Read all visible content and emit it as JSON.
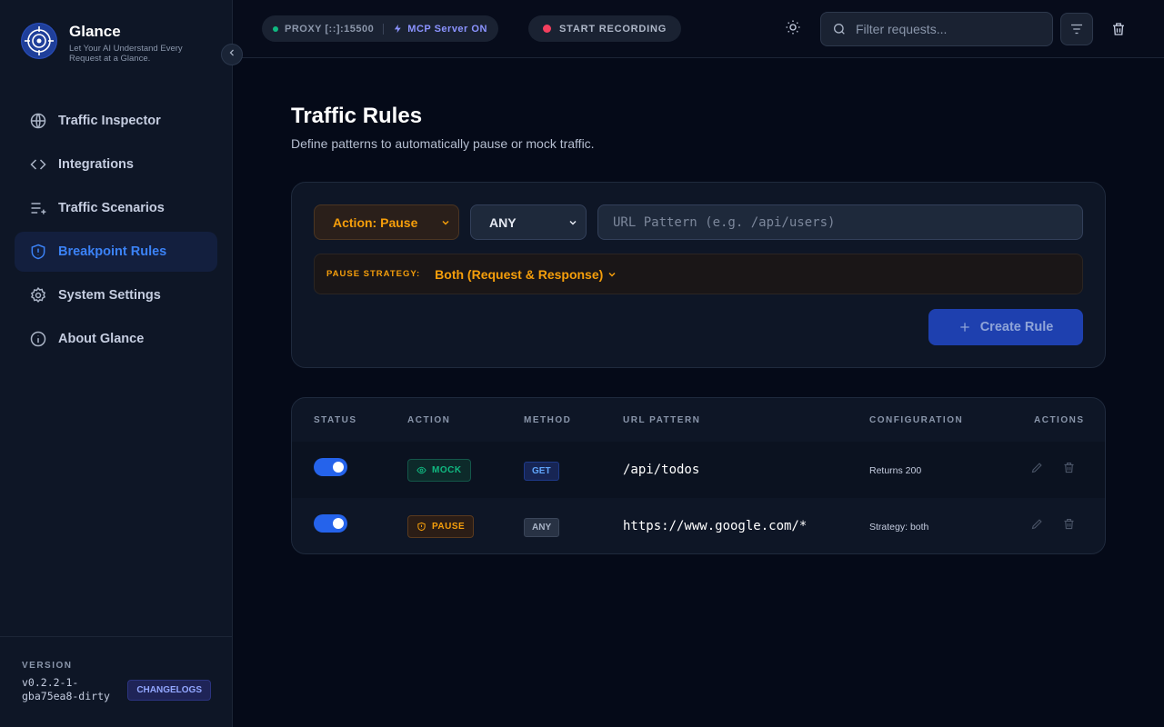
{
  "brand": {
    "title": "Glance",
    "tagline": "Let Your AI Understand Every Request at a Glance."
  },
  "nav": [
    {
      "label": "Traffic Inspector",
      "icon": "globe-icon",
      "active": false
    },
    {
      "label": "Integrations",
      "icon": "code-icon",
      "active": false
    },
    {
      "label": "Traffic Scenarios",
      "icon": "list-plus-icon",
      "active": false
    },
    {
      "label": "Breakpoint Rules",
      "icon": "shield-alert-icon",
      "active": true
    },
    {
      "label": "System Settings",
      "icon": "gear-icon",
      "active": false
    },
    {
      "label": "About Glance",
      "icon": "info-icon",
      "active": false
    }
  ],
  "footer": {
    "version_label": "VERSION",
    "version": "v0.2.2-1-gba75ea8-dirty",
    "changelogs": "CHANGELOGS"
  },
  "topbar": {
    "proxy": "PROXY [::]:15500",
    "mcp": "MCP Server ON",
    "record": "START RECORDING",
    "search_placeholder": "Filter requests..."
  },
  "page": {
    "title": "Traffic Rules",
    "subtitle": "Define patterns to automatically pause or mock traffic."
  },
  "form": {
    "action": "Action: Pause",
    "method": "ANY",
    "url_placeholder": "URL Pattern (e.g. /api/users)",
    "strategy_label": "PAUSE STRATEGY:",
    "strategy_value": "Both (Request & Response)",
    "create": "Create Rule"
  },
  "table": {
    "headers": {
      "status": "STATUS",
      "action": "ACTION",
      "method": "METHOD",
      "url": "URL PATTERN",
      "config": "CONFIGURATION",
      "actions": "ACTIONS"
    },
    "rows": [
      {
        "enabled": true,
        "action": "MOCK",
        "method": "GET",
        "url": "/api/todos",
        "config": "Returns 200"
      },
      {
        "enabled": true,
        "action": "PAUSE",
        "method": "ANY",
        "url": "https://www.google.com/*",
        "config": "Strategy: both"
      }
    ]
  },
  "colors": {
    "accent": "#3b82f6",
    "mock": "#10b981",
    "pause": "#f59e0b",
    "record": "#f43f5e"
  }
}
